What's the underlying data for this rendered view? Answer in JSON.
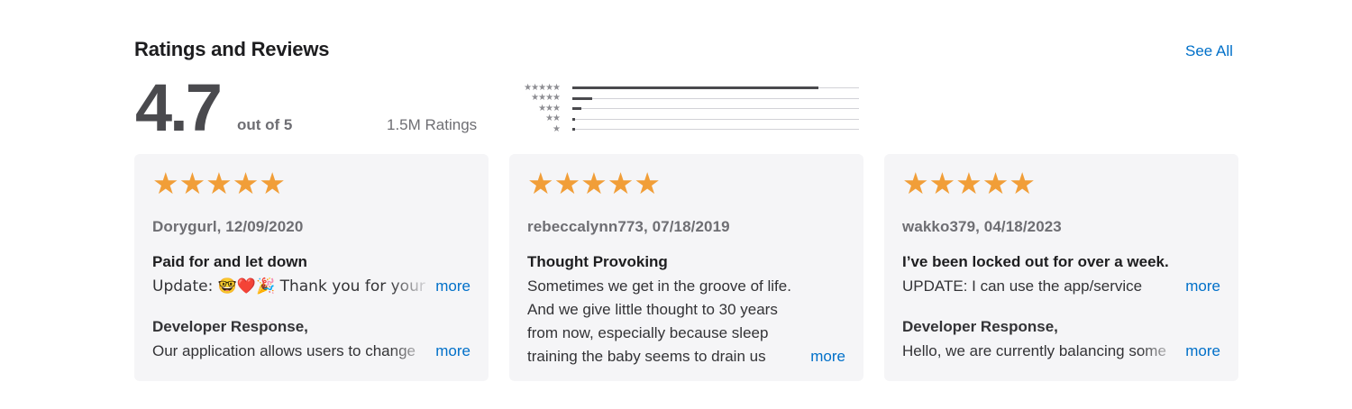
{
  "header": {
    "title": "Ratings and Reviews",
    "see_all": "See All"
  },
  "summary": {
    "score": "4.7",
    "out_of": "out of 5",
    "total": "1.5M Ratings"
  },
  "histogram": [
    {
      "stars": "★★★★★",
      "fraction": 0.86
    },
    {
      "stars": "★★★★",
      "fraction": 0.07
    },
    {
      "stars": "★★★",
      "fraction": 0.03
    },
    {
      "stars": "★★",
      "fraction": 0.01
    },
    {
      "stars": "★",
      "fraction": 0.01
    }
  ],
  "colors": {
    "accent": "#0070c9",
    "star": "#f19e38",
    "card_bg": "#f5f5f7"
  },
  "reviews": [
    {
      "stars": "★★★★★",
      "meta": "Dorygurl, 12/09/2020",
      "title": "Paid for and let down",
      "body": "Update: 🤓❤️🎉 Thank you for your",
      "more": "more",
      "dev_title": "Developer Response,",
      "dev_body": "Our application allows users to change",
      "dev_more": "more"
    },
    {
      "stars": "★★★★★",
      "meta": "rebeccalynn773, 07/18/2019",
      "title": "Thought Provoking",
      "body_lines": [
        "Sometimes we get in the groove of life.",
        "And we give little thought to 30 years",
        "from now, especially because sleep"
      ],
      "body_last": "training the baby seems to drain us",
      "more": "more"
    },
    {
      "stars": "★★★★★",
      "meta": "wakko379, 04/18/2023",
      "title": "I’ve been locked out for over a week.",
      "body": "UPDATE: I can use the app/service",
      "more": "more",
      "dev_title": "Developer Response,",
      "dev_body": "Hello, we are currently balancing some",
      "dev_more": "more"
    }
  ]
}
